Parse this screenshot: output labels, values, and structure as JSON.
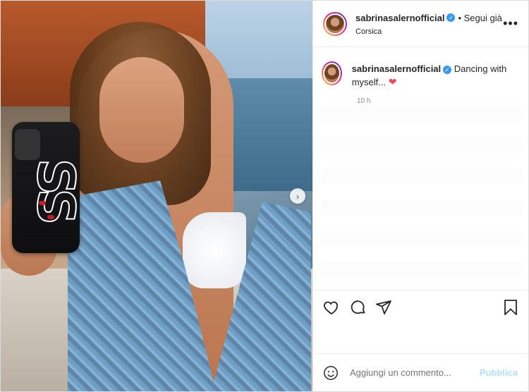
{
  "post": {
    "username": "sabrinasalernofficial",
    "verified_mark": "✓",
    "follow_status": "• Segui già",
    "location": "Corsica",
    "more_icon": "more-options-icon",
    "caption_text": "Dancing with myself...",
    "caption_emoji": "❤",
    "time_ago": "10 h",
    "phone_case_text": "SS"
  },
  "actions": {
    "like_icon": "heart-outline-icon",
    "comment_icon": "comment-bubble-icon",
    "share_icon": "paper-plane-icon",
    "save_icon": "bookmark-icon"
  },
  "comment_box": {
    "placeholder": "Aggiungi un commento...",
    "publish_label": "Pubblica"
  },
  "carousel": {
    "next_arrow": "›"
  },
  "colors": {
    "verified_blue": "#3897f0",
    "heart_red": "#ed4956",
    "publish_disabled": "#b2dffc"
  }
}
